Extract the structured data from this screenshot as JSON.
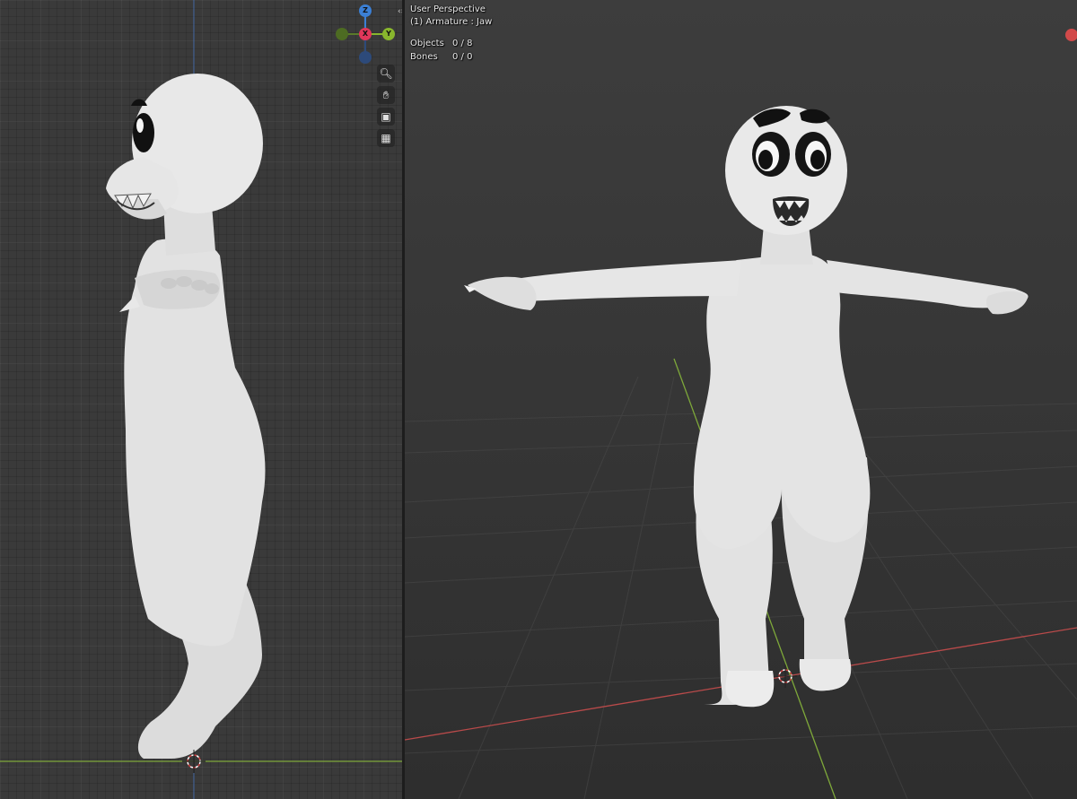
{
  "viewport_right": {
    "view_name": "User Perspective",
    "active_object": "(1) Armature : Jaw",
    "stats": [
      {
        "label": "Objects",
        "value": "0 / 8"
      },
      {
        "label": "Bones",
        "value": "0 / 0"
      }
    ]
  },
  "gizmo": {
    "axes": [
      {
        "name": "Z",
        "color": "#3b7fd4"
      },
      {
        "name": "X",
        "color": "#e0375a"
      },
      {
        "name": "Y",
        "color": "#88b62d"
      }
    ]
  },
  "nav_tools": [
    {
      "icon": "zoom-icon"
    },
    {
      "icon": "pan-hand-icon"
    },
    {
      "icon": "camera-view-icon"
    },
    {
      "icon": "ortho-grid-icon"
    }
  ],
  "colors": {
    "x_axis": "#b94a4a",
    "y_axis": "#7ea83a",
    "z_axis": "#4a78c0",
    "mesh": "#e6e6e6"
  }
}
